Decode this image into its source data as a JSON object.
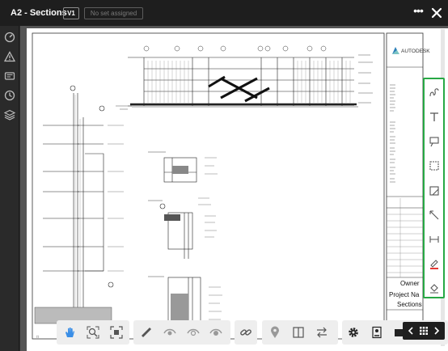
{
  "header": {
    "title": "A2 - Sections",
    "version": "V1",
    "set_status": "No set assigned"
  },
  "title_block": {
    "brand": "AUTODESK",
    "owner": "Owner",
    "project": "Project Na",
    "sheet_name": "Sections"
  },
  "colors": {
    "markup_border": "#27a844",
    "active_tool": "#3a8ee6",
    "pen_red": "#e53935"
  },
  "sidebar": {
    "items": [
      {
        "icon": "gauge-icon"
      },
      {
        "icon": "warning-icon"
      },
      {
        "icon": "rfi-icon"
      },
      {
        "icon": "clock-icon"
      },
      {
        "icon": "layers-icon"
      }
    ]
  },
  "markup_tools": [
    "freehand-pen-icon",
    "text-icon",
    "callout-icon",
    "cloud-icon",
    "shape-icon",
    "arrow-line-icon",
    "dimension-icon",
    "pen-color-icon",
    "fill-icon"
  ],
  "bottom_tools": {
    "navigation": [
      "pan-hand-icon",
      "zoom-window-icon",
      "fit-view-icon"
    ],
    "measure": [
      "measure-ruler-icon",
      "eye-icon",
      "eye-outline-icon",
      "eye-filled-icon"
    ],
    "links": [
      "link-icon"
    ],
    "compare": [
      "location-pin-icon",
      "split-view-icon",
      "swap-arrows-icon"
    ],
    "settings": [
      "gear-icon",
      "properties-icon",
      "camera-icon"
    ]
  }
}
